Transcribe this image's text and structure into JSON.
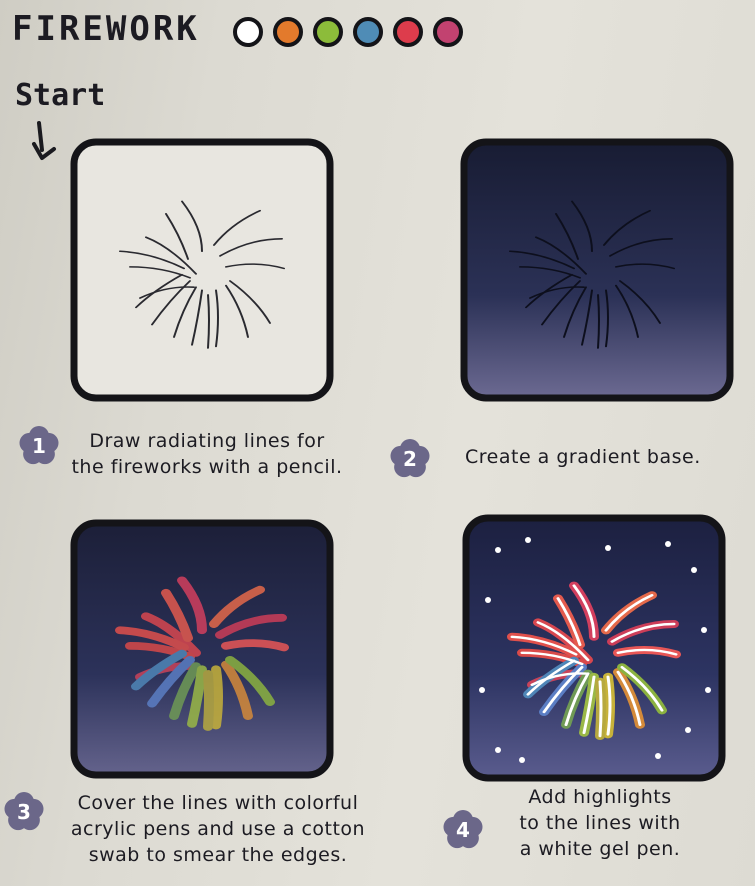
{
  "title": "FIREWORK",
  "palette": [
    "#ffffff",
    "#e37a2c",
    "#8cbc3a",
    "#4f8cb6",
    "#dd3c4c",
    "#c24270"
  ],
  "start_label": "Start",
  "steps": [
    {
      "number": "1",
      "lines": [
        "Draw radiating lines for",
        "the fireworks with a pencil."
      ]
    },
    {
      "number": "2",
      "lines": [
        "Create a gradient base."
      ]
    },
    {
      "number": "3",
      "lines": [
        "Cover the lines with colorful",
        "acrylic pens and use a cotton",
        "swab to smear the edges."
      ]
    },
    {
      "number": "4",
      "lines": [
        "Add highlights",
        "to the lines with",
        "a white gel pen."
      ]
    }
  ]
}
